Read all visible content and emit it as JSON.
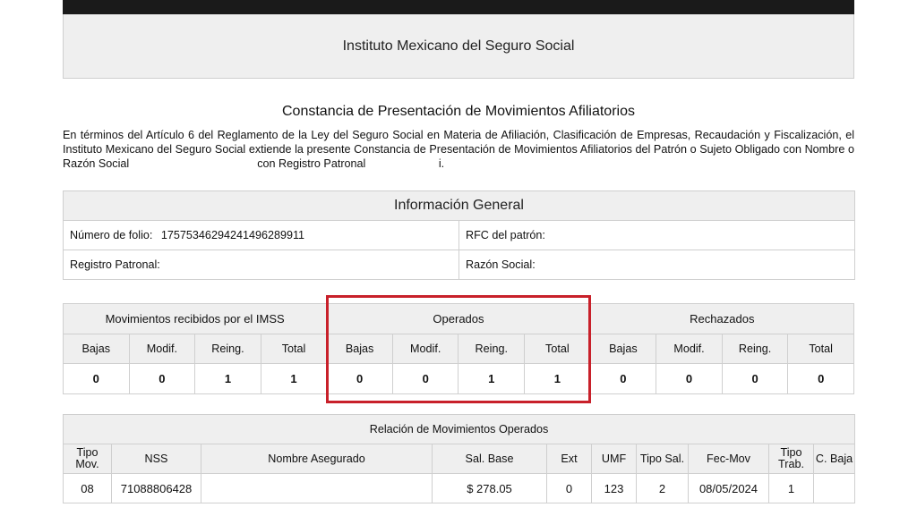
{
  "header": {
    "institution": "Instituto Mexicano del Seguro Social"
  },
  "document": {
    "title": "Constancia de Presentación de Movimientos Afiliatorios",
    "intro_part1": "En términos del Artículo 6 del Reglamento de la Ley del Seguro Social en Materia de Afiliación, Clasificación de Empresas, Recaudación y Fiscalización, el Instituto Mexicano del Seguro Social extiende la presente Constancia de Presentación de Movimientos Afiliatorios del Patrón o Sujeto Obligado con Nombre o Razón Social",
    "intro_part2": "con Registro Patronal",
    "intro_part3": "i."
  },
  "info": {
    "title": "Información General",
    "folio_label": "Número de folio:",
    "folio_value": "1757534629424149628991‌1",
    "rfc_label": "RFC del patrón:",
    "registro_label": "Registro Patronal:",
    "razon_label": "Razón Social:"
  },
  "movimientos": {
    "groups": [
      "Movimientos recibidos por el IMSS",
      "Operados",
      "Rechazados"
    ],
    "sub_headers": [
      "Bajas",
      "Modif.",
      "Reing.",
      "Total"
    ],
    "recibidos": [
      "0",
      "0",
      "1",
      "1"
    ],
    "operados": [
      "0",
      "0",
      "1",
      "1"
    ],
    "rechazados": [
      "0",
      "0",
      "0",
      "0"
    ]
  },
  "relacion": {
    "title": "Relación de Movimientos Operados",
    "headers": [
      "Tipo Mov.",
      "NSS",
      "Nombre Asegurado",
      "Sal. Base",
      "Ext",
      "UMF",
      "Tipo Sal.",
      "Fec-Mov",
      "Tipo Trab.",
      "C. Baja"
    ],
    "row": [
      "08",
      "71088806428",
      "",
      "$ 278.05",
      "0",
      "123",
      "2",
      "08/05/2024",
      "1",
      ""
    ]
  },
  "colors": {
    "highlight": "#c8202a",
    "header_bg": "#efefef",
    "border": "#cfcfcf"
  }
}
